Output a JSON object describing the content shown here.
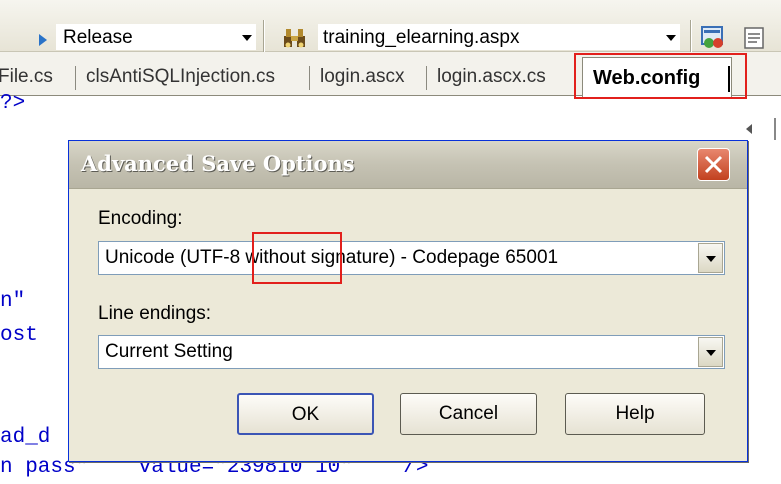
{
  "toolbar": {
    "configuration": "Release",
    "start_page": "training_elearning.aspx"
  },
  "tabs": [
    {
      "label": "File.cs"
    },
    {
      "label": "clsAntiSQLInjection.cs"
    },
    {
      "label": "login.ascx"
    },
    {
      "label": "login.ascx.cs"
    },
    {
      "label": "Web.config",
      "active": true
    }
  ],
  "code_lines": [
    "?>",
    "n\"",
    "ost",
    "ad_d",
    "n pass\"    value=\"239810 10\"    />"
  ],
  "dialog": {
    "title": "Advanced Save Options",
    "encoding_label": "Encoding:",
    "encoding_value": "Unicode (UTF-8 without signature) - Codepage 65001",
    "line_endings_label": "Line endings:",
    "line_endings_value": "Current Setting",
    "ok_label": "OK",
    "cancel_label": "Cancel",
    "help_label": "Help"
  },
  "colors": {
    "highlight": "#e2201c",
    "code": "#0000c8",
    "dialog_bg": "#ece9d8"
  }
}
